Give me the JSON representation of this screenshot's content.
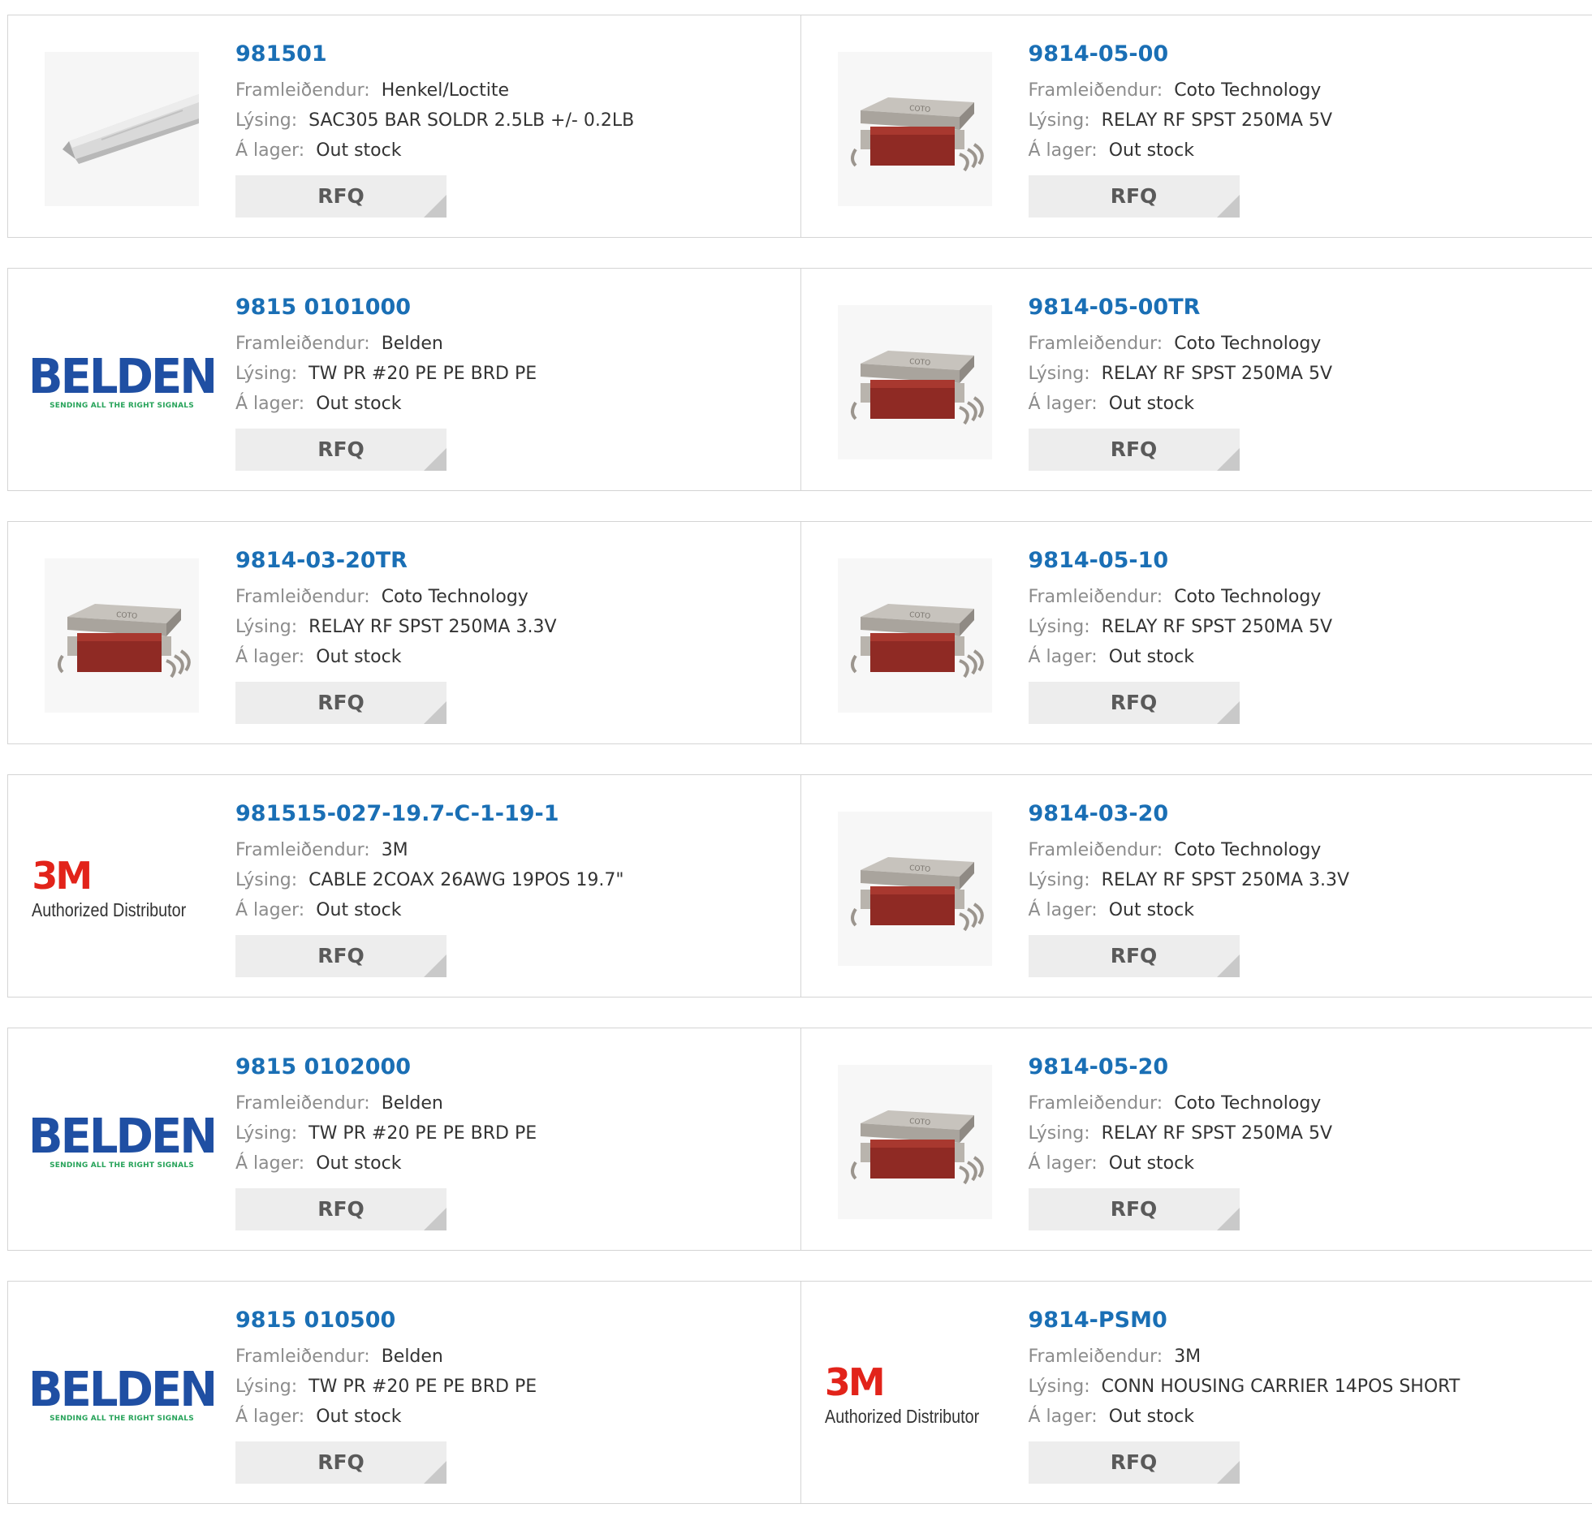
{
  "labels": {
    "manufacturer": "Framleiðendur:",
    "description": "Lýsing:",
    "stock": "Á lager:",
    "rfq": "RFQ"
  },
  "colors": {
    "part_link": "#1a6fb5",
    "label": "#8c8c8c",
    "value": "#333333",
    "rfq_bg": "#ededed",
    "belden_blue": "#1f4fa3",
    "belden_green": "#27a35a",
    "mmm_red": "#e2231a"
  },
  "logos": {
    "belden": {
      "word": "BELDEN",
      "tagline": "SENDING ALL THE RIGHT SIGNALS"
    },
    "mmm": {
      "mark": "3M",
      "tagline": "Authorized Distributor"
    }
  },
  "products": [
    {
      "part": "981501",
      "manufacturer": "Henkel/Loctite",
      "description": "SAC305 BAR SOLDR 2.5LB +/- 0.2LB",
      "stock": "Out stock",
      "image": "solder-bar-photo"
    },
    {
      "part": "9814-05-00",
      "manufacturer": "Coto Technology",
      "description": "RELAY RF SPST 250MA 5V",
      "stock": "Out stock",
      "image": "relay-photo"
    },
    {
      "part": "9815 0101000",
      "manufacturer": "Belden",
      "description": "TW PR #20 PE PE BRD PE",
      "stock": "Out stock",
      "image": "belden-logo"
    },
    {
      "part": "9814-05-00TR",
      "manufacturer": "Coto Technology",
      "description": "RELAY RF SPST 250MA 5V",
      "stock": "Out stock",
      "image": "relay-photo"
    },
    {
      "part": "9814-03-20TR",
      "manufacturer": "Coto Technology",
      "description": "RELAY RF SPST 250MA 3.3V",
      "stock": "Out stock",
      "image": "relay-photo"
    },
    {
      "part": "9814-05-10",
      "manufacturer": "Coto Technology",
      "description": "RELAY RF SPST 250MA 5V",
      "stock": "Out stock",
      "image": "relay-photo"
    },
    {
      "part": "981515-027-19.7-C-1-19-1",
      "manufacturer": "3M",
      "description": "CABLE 2COAX 26AWG 19POS 19.7\"",
      "stock": "Out stock",
      "image": "3m-logo"
    },
    {
      "part": "9814-03-20",
      "manufacturer": "Coto Technology",
      "description": "RELAY RF SPST 250MA 3.3V",
      "stock": "Out stock",
      "image": "relay-photo"
    },
    {
      "part": "9815 0102000",
      "manufacturer": "Belden",
      "description": "TW PR #20 PE PE BRD PE",
      "stock": "Out stock",
      "image": "belden-logo"
    },
    {
      "part": "9814-05-20",
      "manufacturer": "Coto Technology",
      "description": "RELAY RF SPST 250MA 5V",
      "stock": "Out stock",
      "image": "relay-photo"
    },
    {
      "part": "9815 010500",
      "manufacturer": "Belden",
      "description": "TW PR #20 PE PE BRD PE",
      "stock": "Out stock",
      "image": "belden-logo"
    },
    {
      "part": "9814-PSM0",
      "manufacturer": "3M",
      "description": "CONN HOUSING CARRIER 14POS SHORT",
      "stock": "Out stock",
      "image": "3m-logo"
    }
  ]
}
